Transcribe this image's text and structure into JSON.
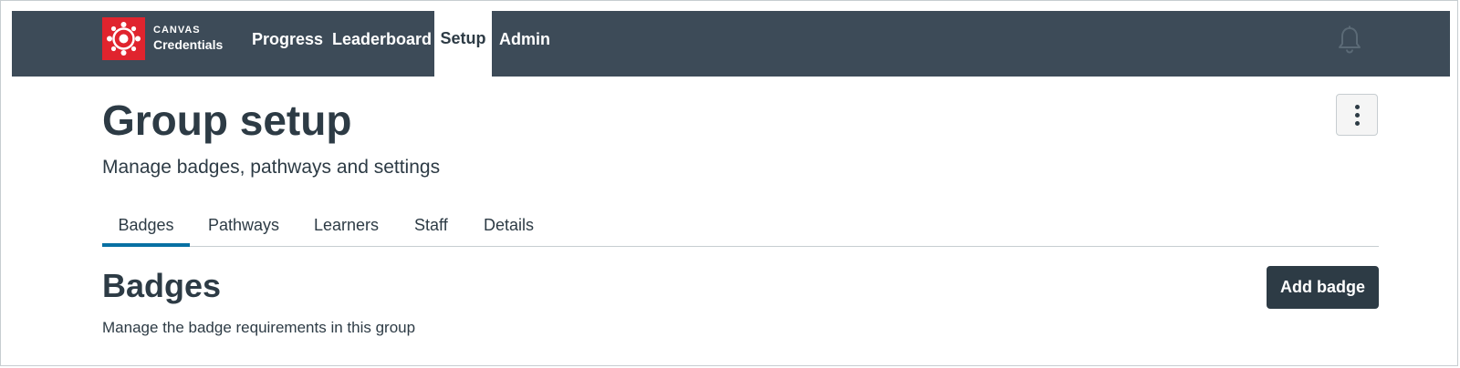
{
  "header": {
    "logo": {
      "line1": "CANVAS",
      "line2": "Credentials",
      "icon": "canvas-logo-icon",
      "color": "#e0242e"
    },
    "nav": [
      {
        "label": "Progress",
        "active": false
      },
      {
        "label": "Leaderboard",
        "active": false
      },
      {
        "label": "Setup",
        "active": true
      },
      {
        "label": "Admin",
        "active": false
      }
    ],
    "notification_icon": "bell-icon",
    "background": "#3d4b58"
  },
  "page": {
    "title": "Group setup",
    "subtitle": "Manage badges, pathways and settings",
    "options_icon": "kebab-menu-icon"
  },
  "tabs": [
    {
      "label": "Badges",
      "active": true
    },
    {
      "label": "Pathways",
      "active": false
    },
    {
      "label": "Learners",
      "active": false
    },
    {
      "label": "Staff",
      "active": false
    },
    {
      "label": "Details",
      "active": false
    }
  ],
  "section": {
    "title": "Badges",
    "description": "Manage the badge requirements in this group",
    "add_button_label": "Add badge"
  },
  "colors": {
    "text": "#2d3b45",
    "tab_active_underline": "#0770a3",
    "button_bg": "#2d3b45"
  }
}
